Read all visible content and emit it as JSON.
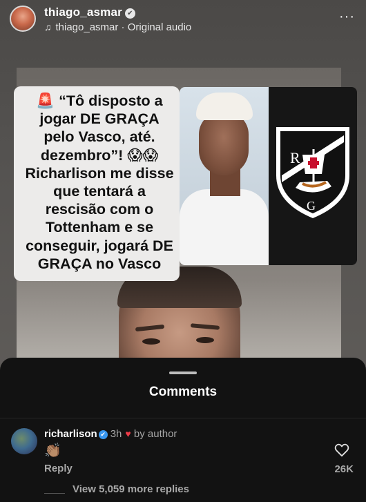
{
  "post": {
    "username": "thiago_asmar",
    "audio_text": "thiago_asmar · Original audio",
    "more_label": "···",
    "quote_text": "🚨 “Tô disposto a jogar DE GRAÇA pelo Vasco, até. dezembro”! 😱😱 Richarlison me disse que tentará a rescisão com o Tottenham e se conseguir, jogará DE GRAÇA no Vasco"
  },
  "comments": {
    "title": "Comments",
    "items": [
      {
        "username": "richarlison",
        "time": "3h",
        "by_author": "by author",
        "text": "👏🏽",
        "reply_label": "Reply",
        "like_count": "26K",
        "view_replies": "View 5,059 more replies"
      }
    ]
  },
  "colors": {
    "accent_red": "#ed3b48",
    "verified_blue": "#3897f0",
    "sheet_bg": "#121212"
  },
  "icons": [
    "verified-icon",
    "music-note-icon",
    "more-options-icon",
    "heart-icon",
    "clap-emoji"
  ]
}
